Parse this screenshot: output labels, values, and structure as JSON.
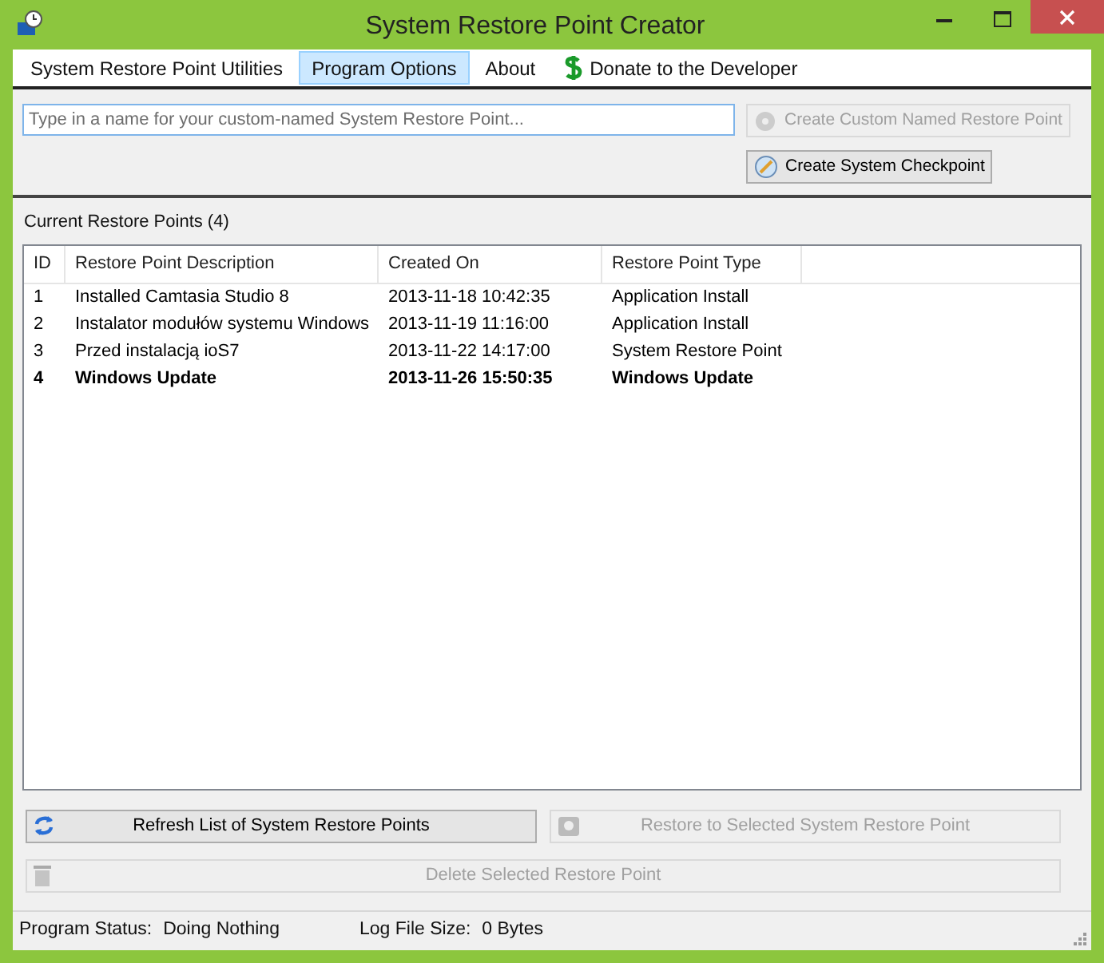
{
  "window": {
    "title": "System Restore Point Creator"
  },
  "menu": [
    {
      "label": "System Restore Point Utilities",
      "selected": false,
      "kind": "text"
    },
    {
      "label": "Program Options",
      "selected": true,
      "kind": "text"
    },
    {
      "label": "About",
      "selected": false,
      "kind": "text"
    },
    {
      "label": "Donate to the Developer",
      "selected": false,
      "kind": "donate"
    }
  ],
  "name_field": {
    "placeholder": "Type in a name for your custom-named System Restore Point..."
  },
  "create_custom_button": {
    "label": "Create Custom Named Restore Point",
    "disabled": true
  },
  "checkpoint_button": {
    "label": "Create System Checkpoint",
    "disabled": false
  },
  "list_title": "Current Restore Points (4)",
  "table": {
    "columns": [
      "ID",
      "Restore Point Description",
      "Created On",
      "Restore Point Type"
    ],
    "rows": [
      {
        "cells": [
          "1",
          "Installed Camtasia Studio 8",
          "2013-11-18 10:42:35",
          "Application Install"
        ],
        "bold": false
      },
      {
        "cells": [
          "2",
          "Instalator modułów systemu Windows",
          "2013-11-19 11:16:00",
          "Application Install"
        ],
        "bold": false
      },
      {
        "cells": [
          "3",
          "Przed instalacją ioS7",
          "2013-11-22 14:17:00",
          "System Restore Point"
        ],
        "bold": false
      },
      {
        "cells": [
          "4",
          "Windows Update",
          "2013-11-26 15:50:35",
          "Windows Update"
        ],
        "bold": true
      }
    ]
  },
  "refresh_button": {
    "label": "Refresh List of System Restore Points",
    "disabled": false
  },
  "restore_button": {
    "label": "Restore to Selected System Restore Point",
    "disabled": true
  },
  "delete_button": {
    "label": "Delete Selected Restore Point",
    "disabled": true
  },
  "status_bar": {
    "status_label": "Program Status:",
    "status_value": "Doing Nothing",
    "log_label": "Log File Size:",
    "log_value": "0 Bytes"
  }
}
